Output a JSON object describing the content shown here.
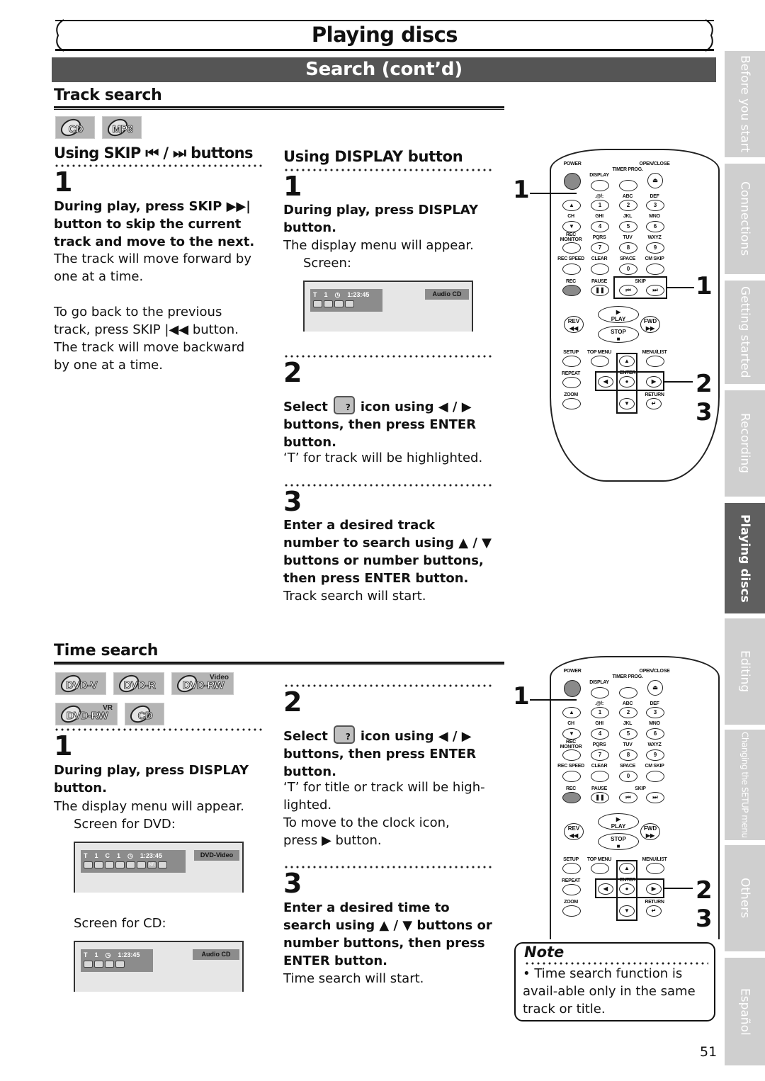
{
  "header": {
    "title": "Playing discs",
    "subtitle": "Search (cont’d)"
  },
  "side_tabs": [
    {
      "label": "Before you start",
      "active": false
    },
    {
      "label": "Connections",
      "active": false
    },
    {
      "label": "Getting started",
      "active": false
    },
    {
      "label": "Recording",
      "active": false
    },
    {
      "label": "Playing discs",
      "active": true
    },
    {
      "label": "Editing",
      "active": false
    },
    {
      "label": "Changing the SETUP menu",
      "active": false
    },
    {
      "label": "Others",
      "active": false
    },
    {
      "label": "Español",
      "active": false
    }
  ],
  "track_search": {
    "heading": "Track search",
    "discs": [
      {
        "label": "CD",
        "sup": ""
      },
      {
        "label": "MP3",
        "sup": ""
      }
    ],
    "skip_method": {
      "heading": "Using SKIP ⏮ / ⏭ buttons",
      "step1": {
        "num": "1",
        "bold": "During play, press SKIP ▶▶| button to skip the current track and move to the next.",
        "text": "The track will move forward by one at a time.",
        "text2": "To go back to the previous track, press SKIP |◀◀ button. The track will move backward by one at a time."
      }
    },
    "display_method": {
      "heading": "Using DISPLAY button",
      "step1": {
        "num": "1",
        "bold": "During play, press DISPLAY button.",
        "text": "The display menu will appear.",
        "screen_label": "Screen:"
      },
      "screen": {
        "t_label": "T",
        "t_value": "1",
        "time": "1:23:45",
        "disc_type": "Audio CD"
      },
      "step2": {
        "num": "2",
        "bold_a": "Select",
        "bold_b": "icon using ◀ / ▶ buttons, then press ENTER button.",
        "text": "‘T’ for track will be highlighted."
      },
      "step3": {
        "num": "3",
        "bold": "Enter a desired track number to search using ▲ / ▼ buttons or number buttons, then press ENTER button.",
        "text": "Track search will start."
      }
    }
  },
  "time_search": {
    "heading": "Time search",
    "discs": [
      {
        "label": "DVD-V",
        "sup": ""
      },
      {
        "label": "DVD-R",
        "sup": ""
      },
      {
        "label": "DVD-RW",
        "sup": "Video"
      },
      {
        "label": "DVD-RW",
        "sup": "VR"
      },
      {
        "label": "CD",
        "sup": ""
      }
    ],
    "step1": {
      "num": "1",
      "bold": "During play, press DISPLAY button.",
      "text": "The display menu will appear.",
      "dvd_screen_label": "Screen for DVD:",
      "cd_screen_label": "Screen for CD:"
    },
    "dvd_screen": {
      "t_label": "T",
      "t_value": "1",
      "c_label": "C",
      "c_value": "1",
      "time": "1:23:45",
      "disc_type": "DVD-Video",
      "nr_label": "NR"
    },
    "cd_screen": {
      "t_label": "T",
      "t_value": "1",
      "time": "1:23:45",
      "disc_type": "Audio CD"
    },
    "step2": {
      "num": "2",
      "bold_a": "Select",
      "bold_b": "icon using ◀ / ▶ buttons, then press ENTER button.",
      "text": "‘T’ for title or track will be high-lighted.",
      "text2": "To move to the clock icon, press ▶ button."
    },
    "step3": {
      "num": "3",
      "bold": "Enter a desired time to search using ▲ / ▼ buttons or number buttons, then press ENTER button.",
      "text": "Time search will start."
    }
  },
  "remote": {
    "labels": {
      "power": "POWER",
      "display": "DISPLAY",
      "timer_prog": "TIMER PROG.",
      "open_close": "OPEN/CLOSE",
      "sym": ".@/:",
      "abc": "ABC",
      "def": "DEF",
      "ch": "CH",
      "ghi": "GHI",
      "jkl": "JKL",
      "mno": "MNO",
      "rec_monitor": "REC MONITOR",
      "pqrs": "PQRS",
      "tuv": "TUV",
      "wxyz": "WXYZ",
      "rec_speed": "REC SPEED",
      "clear": "CLEAR",
      "space": "SPACE",
      "cm_skip": "CM SKIP",
      "rec": "REC",
      "pause": "PAUSE",
      "skip": "SKIP",
      "play": "PLAY",
      "rev": "REV",
      "fwd": "FWD",
      "stop": "STOP",
      "setup": "SETUP",
      "top_menu": "TOP MENU",
      "menu_list": "MENU/LIST",
      "repeat": "REPEAT",
      "enter": "ENTER",
      "zoom": "ZOOM",
      "return": "RETURN"
    },
    "digits": [
      "1",
      "2",
      "3",
      "4",
      "5",
      "6",
      "7",
      "8",
      "9",
      "0"
    ],
    "top_callouts": {
      "display": "1",
      "skip": "1",
      "arrows": "2",
      "enter": "3"
    },
    "bottom_callouts": {
      "display": "1",
      "arrows": "2",
      "enter": "3"
    }
  },
  "note": {
    "title": "Note",
    "text": "• Time search function is avail-able only in the same track or title."
  },
  "page_number": "51"
}
